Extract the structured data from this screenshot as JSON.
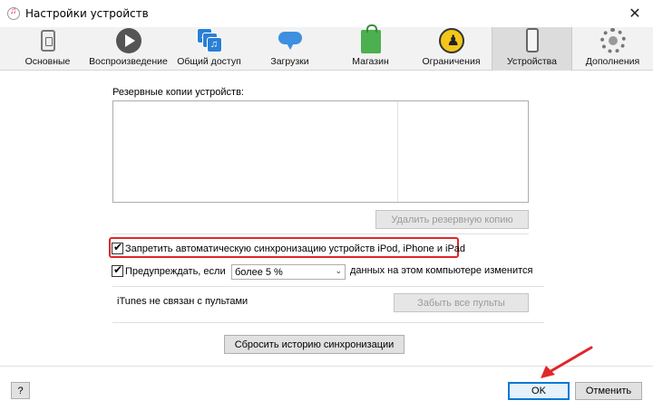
{
  "window": {
    "title": "Настройки устройств",
    "close_glyph": "✕"
  },
  "toolbar": {
    "tabs": [
      {
        "label": "Основные",
        "icon": "general-icon"
      },
      {
        "label": "Воспроизведение",
        "icon": "play-icon"
      },
      {
        "label": "Общий доступ",
        "icon": "sharing-icon"
      },
      {
        "label": "Загрузки",
        "icon": "downloads-icon"
      },
      {
        "label": "Магазин",
        "icon": "store-icon"
      },
      {
        "label": "Ограничения",
        "icon": "restrictions-icon"
      },
      {
        "label": "Устройства",
        "icon": "devices-icon",
        "active": true
      },
      {
        "label": "Дополнения",
        "icon": "gear-icon"
      }
    ]
  },
  "devices": {
    "backups_label": "Резервные копии устройств:",
    "delete_backup_button": "Удалить резервную копию",
    "prevent_sync_label": "Запретить автоматическую синхронизацию устройств iPod, iPhone и iPad",
    "prevent_sync_checked": true,
    "warn_label": "Предупреждать, если",
    "warn_checked": true,
    "warn_select_value": "более 5 %",
    "warn_suffix": "данных на этом компьютере изменится",
    "remotes_status": "iTunes не связан с пультами",
    "forget_remotes_button": "Забыть все пульты",
    "reset_sync_history_button": "Сбросить историю синхронизации"
  },
  "footer": {
    "help_button": "?",
    "ok_button": "OK",
    "cancel_button": "Отменить"
  },
  "colors": {
    "highlight_outline": "#e0262a",
    "ok_border": "#0078d7"
  }
}
